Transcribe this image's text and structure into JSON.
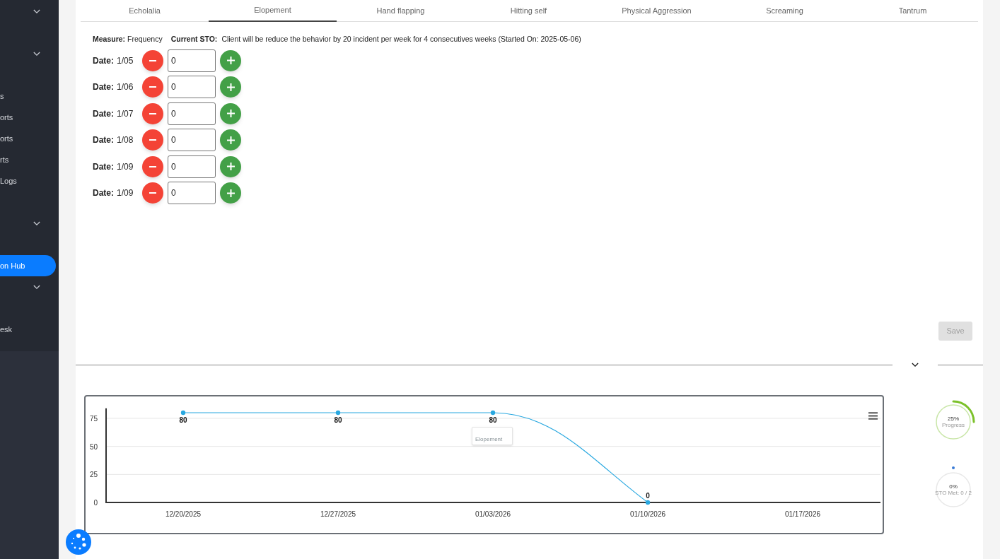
{
  "sidebar": {
    "items": [
      {
        "kind": "group",
        "expanded": false
      },
      {
        "kind": "group",
        "expanded": false
      },
      {
        "kind": "link",
        "label": "s",
        "selected": false
      },
      {
        "kind": "link",
        "label": "orts",
        "selected": false
      },
      {
        "kind": "link",
        "label": "orts",
        "selected": false
      },
      {
        "kind": "link",
        "label": "rts",
        "selected": false
      },
      {
        "kind": "link",
        "label": "Logs",
        "selected": false
      },
      {
        "kind": "group",
        "expanded": false
      },
      {
        "kind": "link",
        "label": "on Hub",
        "selected": true
      },
      {
        "kind": "group",
        "expanded": false
      },
      {
        "kind": "link",
        "label": "esk",
        "selected": false
      }
    ]
  },
  "tabs": [
    {
      "label": "Echolalia",
      "selected": false
    },
    {
      "label": "Elopement",
      "selected": true
    },
    {
      "label": "Hand flapping",
      "selected": false
    },
    {
      "label": "Hitting self",
      "selected": false
    },
    {
      "label": "Physical Aggression",
      "selected": false
    },
    {
      "label": "Screaming",
      "selected": false
    },
    {
      "label": "Tantrum",
      "selected": false
    }
  ],
  "measure": {
    "label": "Measure:",
    "value": "Frequency"
  },
  "current_sto": {
    "label": "Current STO:",
    "value": "Client will be reduce the behavior by 20 incident per week for 4 consecutives weeks (Started On: 2025-05-06)"
  },
  "entries": [
    {
      "label": "Date:",
      "date": "1/05",
      "value": "0"
    },
    {
      "label": "Date:",
      "date": "1/06",
      "value": "0"
    },
    {
      "label": "Date:",
      "date": "1/07",
      "value": "0"
    },
    {
      "label": "Date:",
      "date": "1/08",
      "value": "0"
    },
    {
      "label": "Date:",
      "date": "1/09",
      "value": "0"
    },
    {
      "label": "Date:",
      "date": "1/09",
      "value": "0"
    }
  ],
  "save_button": {
    "label": "Save",
    "disabled": true
  },
  "chart": {
    "chart_data": {
      "type": "line",
      "categories": [
        "12/20/2025",
        "12/27/2025",
        "01/03/2026",
        "01/10/2026",
        "01/17/2026"
      ],
      "series": [
        {
          "name": "Elopement",
          "color": "#29a8e0",
          "values": [
            80,
            80,
            80,
            0,
            null
          ],
          "marker": "circle"
        }
      ],
      "ylim": [
        0,
        84
      ],
      "yticks": [
        0,
        25,
        50,
        75
      ],
      "grid": true,
      "data_labels": true
    }
  },
  "gauges": [
    {
      "value": "25%",
      "label": "Progress",
      "level": 0.25,
      "color": "#7cc12a"
    },
    {
      "value": "0%",
      "label": "STO Met: 0 / 2",
      "color": "#3a7bd5"
    }
  ]
}
